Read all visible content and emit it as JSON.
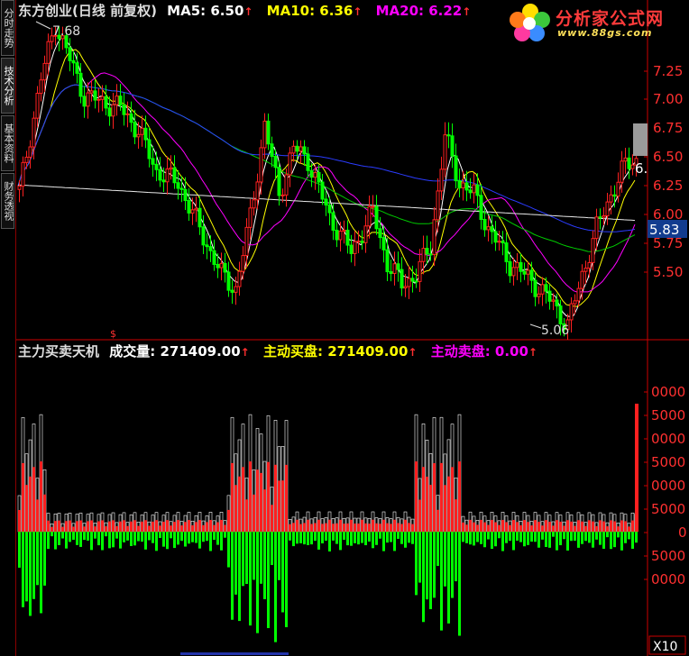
{
  "sidebar": {
    "tabs": [
      {
        "label": "分时走势"
      },
      {
        "label": "技术分析"
      },
      {
        "label": "基本资料"
      },
      {
        "label": "财务透视"
      }
    ]
  },
  "price_panel": {
    "title": "东方创业(日线 前复权)",
    "ma5_label": "MA5: 6.50",
    "ma10_label": "MA10: 6.36",
    "ma20_label": "MA20: 6.22",
    "arrow": "↑",
    "high_marker": "7.68",
    "low_marker": "5.06",
    "last_price": "5.83",
    "last_price_partial": "6.",
    "y_ticks": [
      "7.25",
      "7.00",
      "6.75",
      "6.50",
      "6.25",
      "6.00",
      "5.75",
      "5.50"
    ],
    "dollar_marker": "$"
  },
  "volume_panel": {
    "title": "主力买卖天机",
    "vol_label": "成交量: 271409.00",
    "buy_label": "主动买盘: 271409.00",
    "sell_label": "主动卖盘: 0.00",
    "arrow": "↑",
    "y_ticks": [
      "0000",
      "5000",
      "0000",
      "5000",
      "0000",
      "5000",
      "0",
      "5000",
      "0000"
    ],
    "unit_box": "X10"
  },
  "logo": {
    "title": "分析家公式网",
    "url": "www.88gs.com"
  },
  "colors": {
    "up": "#ff2020",
    "down": "#00ff00",
    "white_line": "#ffffff",
    "ma5": "#ffffff",
    "ma10": "#ffff00",
    "ma20": "#ff00ff",
    "ma60": "#00cc00",
    "ma120": "#2b3cff",
    "ma250": "#e8e8e8",
    "axis": "#cc0000",
    "buy": "#ff2020",
    "sell": "#00ff00"
  }
}
